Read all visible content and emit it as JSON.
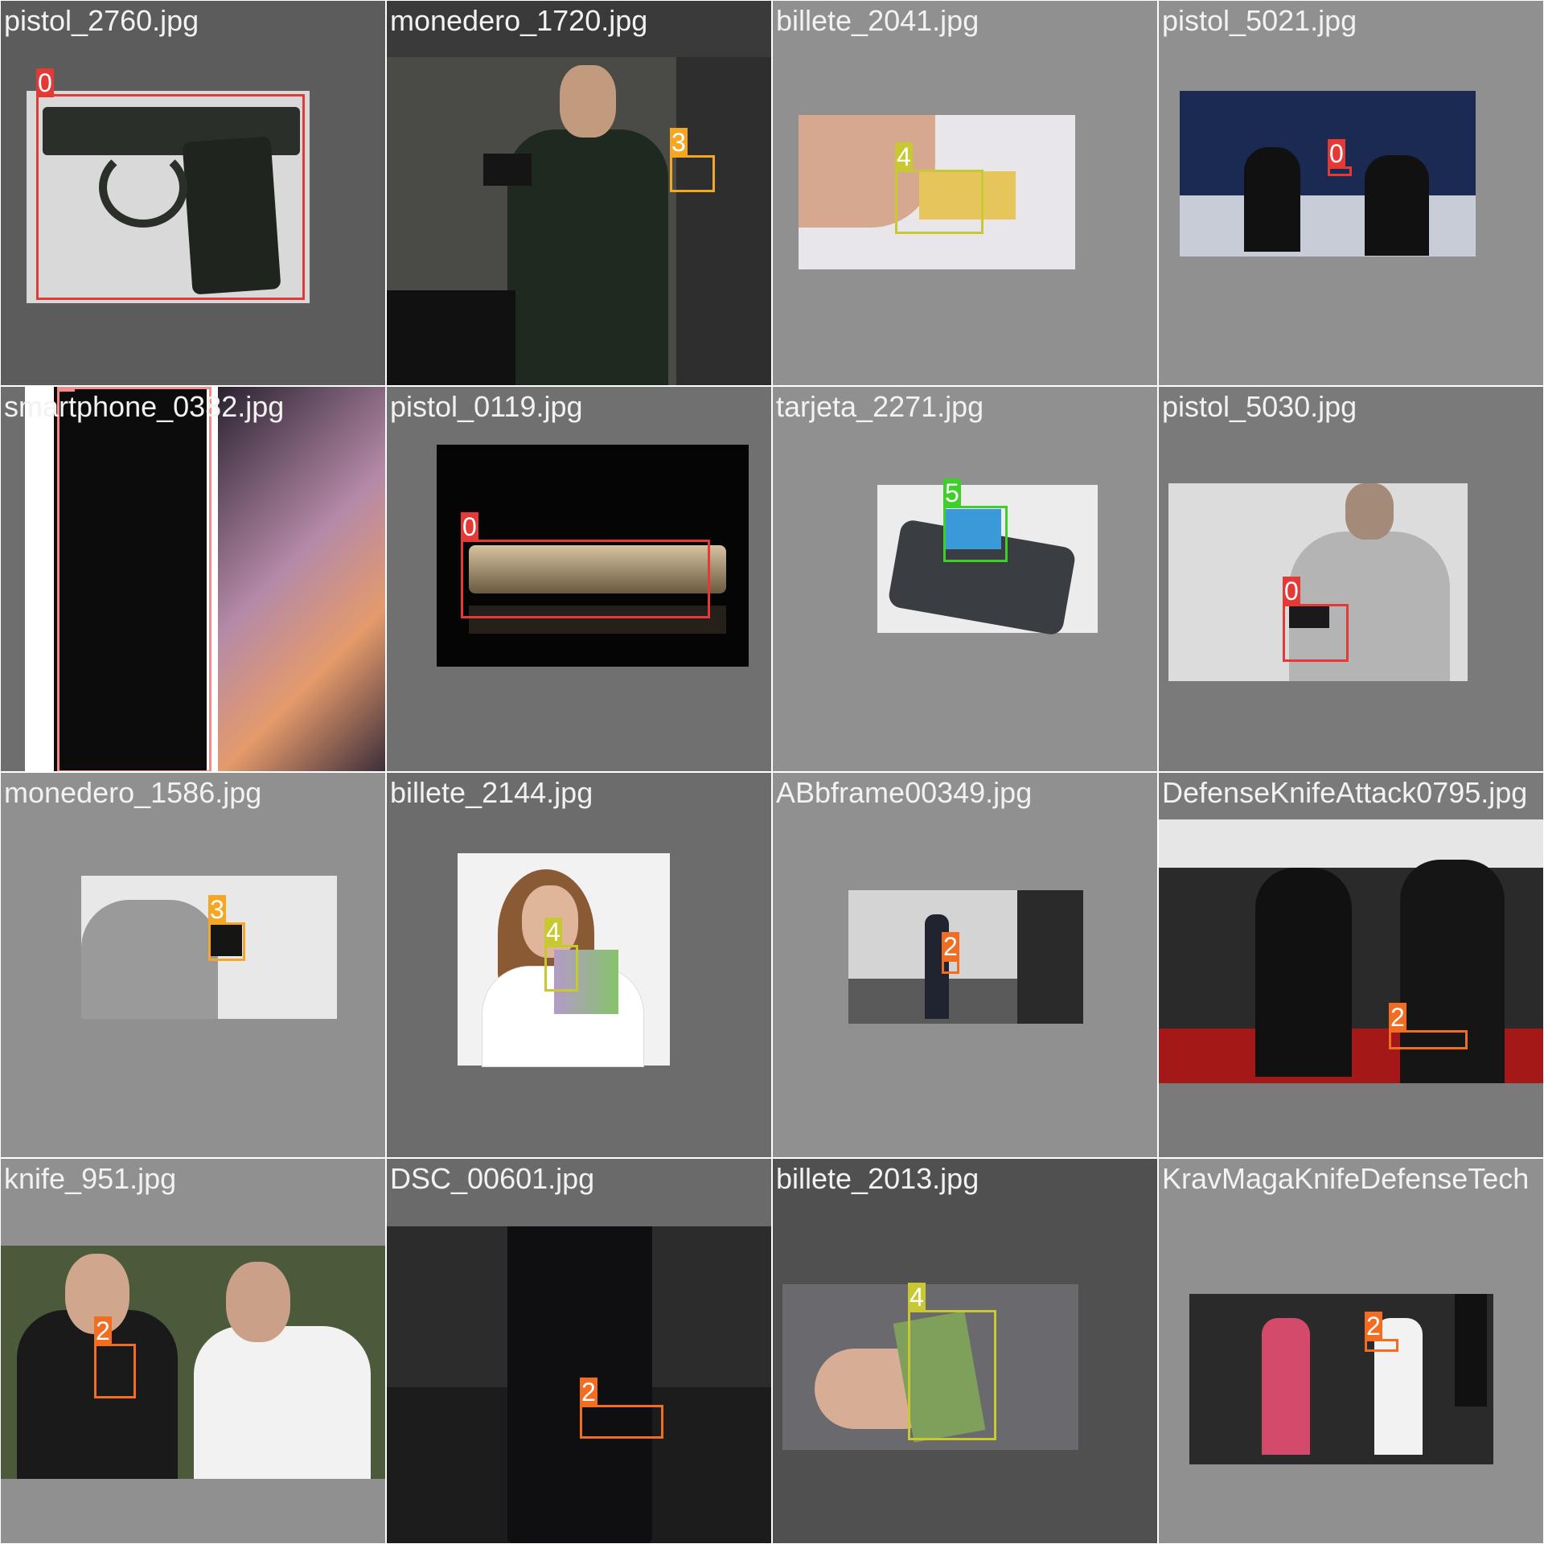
{
  "tiles": [
    {
      "filename": "pistol_2760.jpg",
      "labels": [
        "0"
      ]
    },
    {
      "filename": "monedero_1720.jpg",
      "labels": [
        "3"
      ]
    },
    {
      "filename": "billete_2041.jpg",
      "labels": [
        "4"
      ]
    },
    {
      "filename": "pistol_5021.jpg",
      "labels": [
        "0"
      ]
    },
    {
      "filename": "smartphone_0382.jpg",
      "labels": [
        "1"
      ]
    },
    {
      "filename": "pistol_0119.jpg",
      "labels": [
        "0"
      ]
    },
    {
      "filename": "tarjeta_2271.jpg",
      "labels": [
        "5"
      ]
    },
    {
      "filename": "pistol_5030.jpg",
      "labels": [
        "0"
      ]
    },
    {
      "filename": "monedero_1586.jpg",
      "labels": [
        "3"
      ]
    },
    {
      "filename": "billete_2144.jpg",
      "labels": [
        "4"
      ]
    },
    {
      "filename": "ABbframe00349.jpg",
      "labels": [
        "2"
      ]
    },
    {
      "filename": "DefenseKnifeAttack0795.jpg",
      "labels": [
        "2"
      ]
    },
    {
      "filename": "knife_951.jpg",
      "labels": [
        "2"
      ]
    },
    {
      "filename": "DSC_00601.jpg",
      "labels": [
        "2"
      ]
    },
    {
      "filename": "billete_2013.jpg",
      "labels": [
        "4"
      ]
    },
    {
      "filename": "KravMagaKnifeDefenseTech",
      "labels": [
        "2"
      ]
    }
  ],
  "class_colors": {
    "0": "#e53935",
    "1": "#f48a8a",
    "2": "#f26d21",
    "3": "#f5a623",
    "4": "#c8c832",
    "5": "#3ecf2b"
  }
}
